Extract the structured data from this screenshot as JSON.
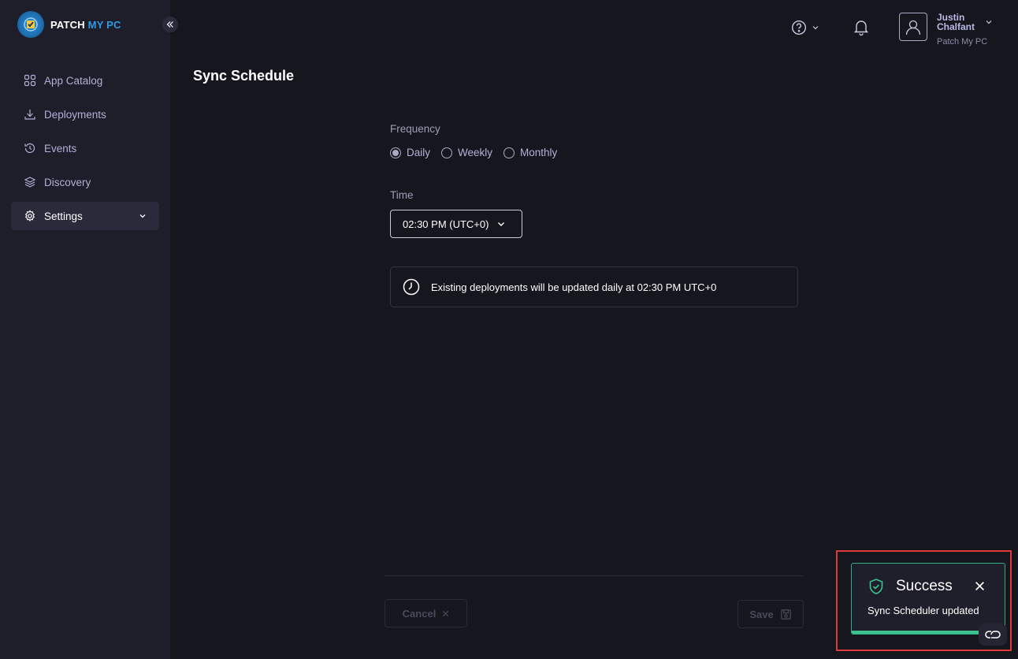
{
  "brand": {
    "name_part1": "PATCH",
    "name_part2": "MY PC",
    "accent_color": "#2f9ae6"
  },
  "sidebar": {
    "items": [
      {
        "label": "App Catalog",
        "icon": "grid-icon",
        "active": false
      },
      {
        "label": "Deployments",
        "icon": "download-icon",
        "active": false
      },
      {
        "label": "Events",
        "icon": "history-icon",
        "active": false
      },
      {
        "label": "Discovery",
        "icon": "layers-icon",
        "active": false
      },
      {
        "label": "Settings",
        "icon": "gear-icon",
        "active": true,
        "expandable": true
      }
    ]
  },
  "header": {
    "user": {
      "first": "Justin",
      "last": "Chalfant",
      "org": "Patch My PC"
    }
  },
  "main": {
    "title": "Sync Schedule",
    "frequency": {
      "label": "Frequency",
      "options": [
        "Daily",
        "Weekly",
        "Monthly"
      ],
      "selected": "Daily"
    },
    "time": {
      "label": "Time",
      "value": "02:30 PM (UTC+0)"
    },
    "info": "Existing deployments will be updated daily at 02:30 PM UTC+0",
    "buttons": {
      "cancel": "Cancel",
      "save": "Save"
    }
  },
  "toast": {
    "title": "Success",
    "message": "Sync Scheduler updated",
    "status_color": "#3ec28d",
    "progress": 0.85
  }
}
